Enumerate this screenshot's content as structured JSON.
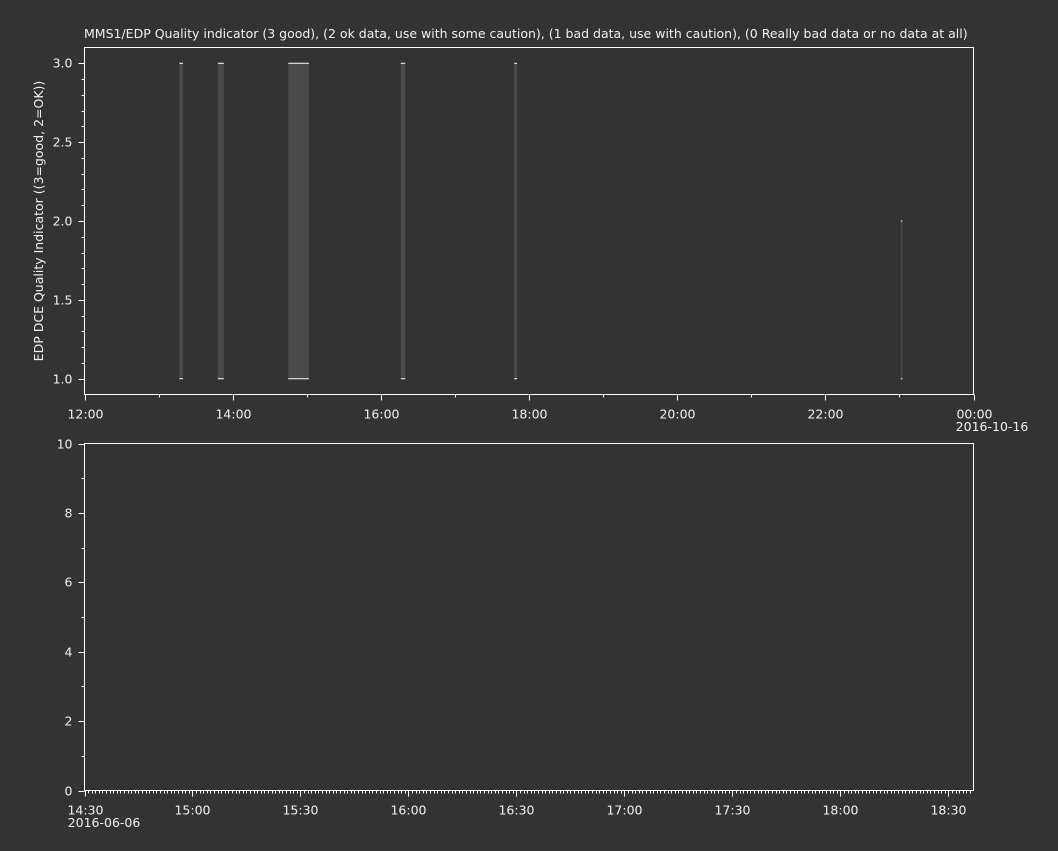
{
  "colors": {
    "background": "#333333",
    "axis": "#ffffff",
    "text": "#f0f0f0",
    "bar_fill": "#4a4a4a",
    "bar_edge": "#ffffff"
  },
  "chart_data": [
    {
      "type": "bar",
      "title": "MMS1/EDP  Quality indicator (3 good), (2 ok data, use with some caution), (1 bad data, use with caution), (0 Really bad data or no data at all)",
      "ylabel": "EDP DCE Quality Indicator ((3=good, 2=OK))",
      "xlabel": "",
      "xlim_hours": [
        12,
        24
      ],
      "ylim": [
        0.9,
        3.1
      ],
      "y_ticks": [
        "1.0",
        "1.5",
        "2.0",
        "2.5",
        "3.0"
      ],
      "y_tick_values": [
        1.0,
        1.5,
        2.0,
        2.5,
        3.0
      ],
      "x_ticks": [
        "12:00",
        "14:00",
        "16:00",
        "18:00",
        "20:00",
        "22:00",
        "00:00"
      ],
      "x_tick_hours": [
        12,
        14,
        16,
        18,
        20,
        22,
        24
      ],
      "x_date_label": "2016-10-16",
      "baseline": 1.0,
      "bars": [
        {
          "start": 13.28,
          "end": 13.33,
          "value": 3.0
        },
        {
          "start": 13.8,
          "end": 13.88,
          "value": 3.0
        },
        {
          "start": 14.75,
          "end": 15.03,
          "value": 3.0
        },
        {
          "start": 16.27,
          "end": 16.33,
          "value": 3.0
        },
        {
          "start": 17.8,
          "end": 17.84,
          "value": 3.0
        },
        {
          "start": 23.02,
          "end": 23.04,
          "value": 2.0
        }
      ],
      "grid": false
    },
    {
      "type": "line",
      "title": "",
      "ylabel": "",
      "xlabel": "",
      "xlim_minutes": [
        870,
        1117
      ],
      "ylim": [
        0,
        10
      ],
      "y_ticks": [
        "0",
        "2",
        "4",
        "6",
        "8",
        "10"
      ],
      "y_tick_values": [
        0,
        2,
        4,
        6,
        8,
        10
      ],
      "x_ticks": [
        "14:30",
        "15:00",
        "15:30",
        "16:00",
        "16:30",
        "17:00",
        "17:30",
        "18:00",
        "18:30"
      ],
      "x_tick_minutes": [
        870,
        900,
        930,
        960,
        990,
        1020,
        1050,
        1080,
        1110
      ],
      "x_date_label": "2016-06-06",
      "series": [],
      "grid": false
    }
  ]
}
